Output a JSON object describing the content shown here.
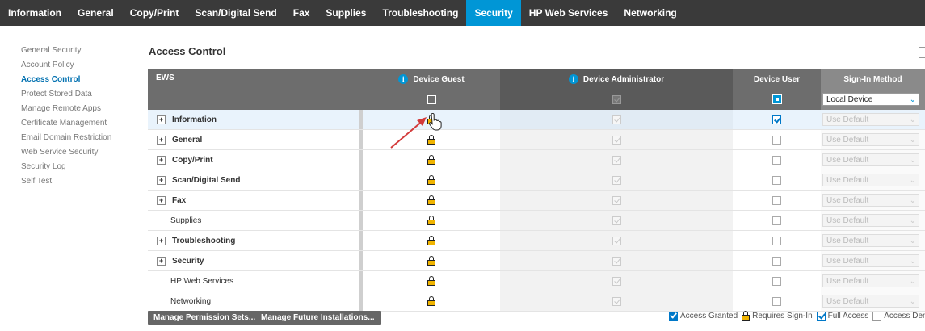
{
  "topnav": {
    "items": [
      "Information",
      "General",
      "Copy/Print",
      "Scan/Digital Send",
      "Fax",
      "Supplies",
      "Troubleshooting",
      "Security",
      "HP Web Services",
      "Networking"
    ],
    "active": "Security"
  },
  "leftnav": {
    "items": [
      "General Security",
      "Account Policy",
      "Access Control",
      "Protect Stored Data",
      "Manage Remote Apps",
      "Certificate Management",
      "Email Domain Restriction",
      "Web Service Security",
      "Security Log",
      "Self Test"
    ],
    "active": "Access Control"
  },
  "page": {
    "title": "Access Control"
  },
  "grid": {
    "headers": {
      "ews": "EWS",
      "guest": "Device Guest",
      "admin": "Device Administrator",
      "user": "Device User",
      "signin": "Sign-In Method"
    },
    "signin_select_value": "Local Device",
    "use_default": "Use Default",
    "rows": [
      {
        "label": "Information",
        "expandable": true,
        "user_checked": true
      },
      {
        "label": "General",
        "expandable": true,
        "user_checked": false
      },
      {
        "label": "Copy/Print",
        "expandable": true,
        "user_checked": false
      },
      {
        "label": "Scan/Digital Send",
        "expandable": true,
        "user_checked": false
      },
      {
        "label": "Fax",
        "expandable": true,
        "user_checked": false
      },
      {
        "label": "Supplies",
        "expandable": false,
        "user_checked": false
      },
      {
        "label": "Troubleshooting",
        "expandable": true,
        "user_checked": false
      },
      {
        "label": "Security",
        "expandable": true,
        "user_checked": false
      },
      {
        "label": "HP Web Services",
        "expandable": false,
        "user_checked": false
      },
      {
        "label": "Networking",
        "expandable": false,
        "user_checked": false
      }
    ]
  },
  "footer": {
    "manage_permission_sets": "Manage Permission Sets...",
    "manage_future_installations": "Manage Future Installations..."
  },
  "legend": {
    "access_granted": "Access Granted",
    "requires_signin": "Requires Sign-In",
    "full_access": "Full Access",
    "access_denied": "Access Den"
  },
  "colors": {
    "nav_bg": "#3a3a3a",
    "accent": "#0096d6",
    "lock": "#f0b400",
    "arrow": "#d33a3a"
  }
}
